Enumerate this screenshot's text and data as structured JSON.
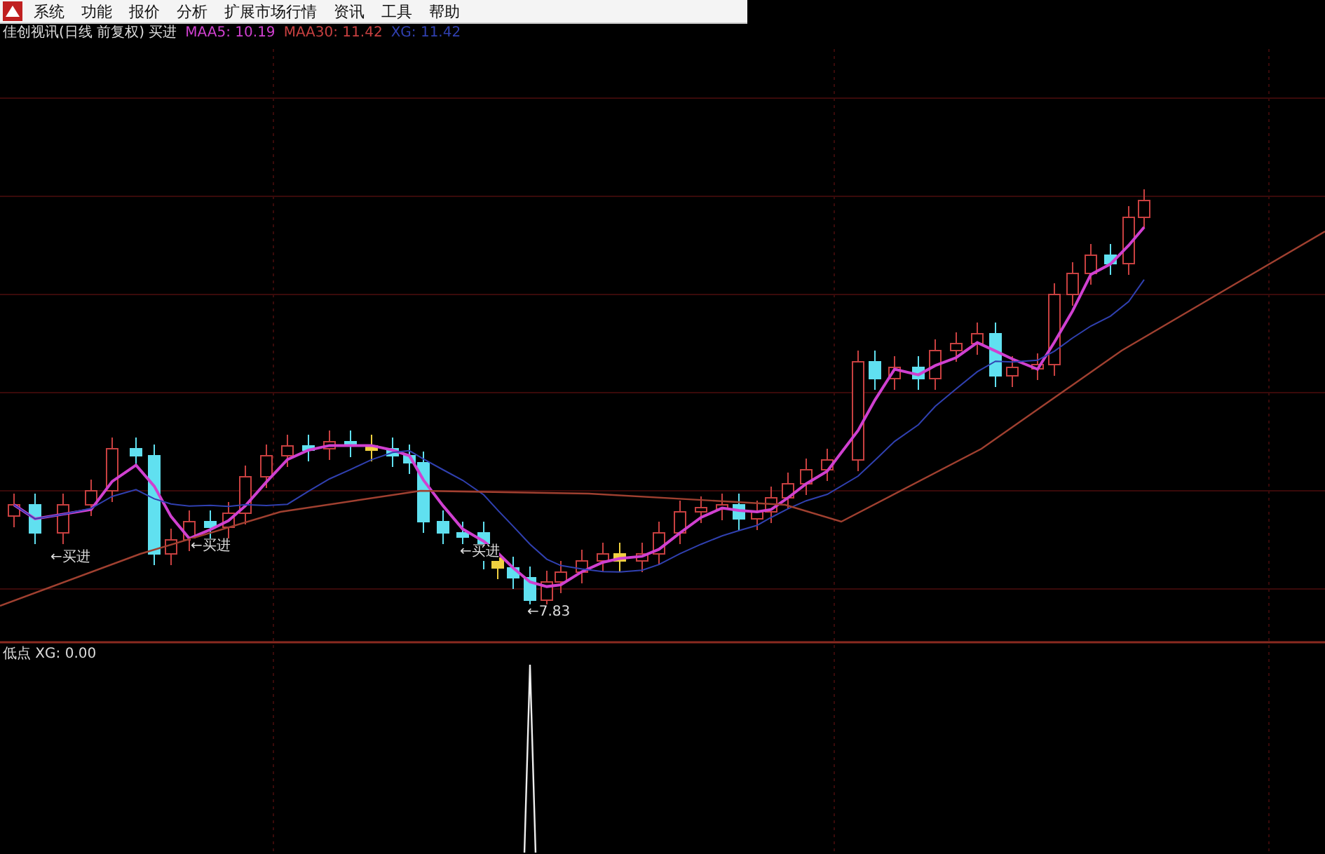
{
  "menu": [
    {
      "label": "系统"
    },
    {
      "label": "功能"
    },
    {
      "label": "报价"
    },
    {
      "label": "分析"
    },
    {
      "label": "扩展市场行情"
    },
    {
      "label": "资讯"
    },
    {
      "label": "工具"
    },
    {
      "label": "帮助"
    }
  ],
  "info_bar": {
    "title": "佳创视讯(日线 前复权) 买进",
    "indicators": [
      {
        "label": "MAA5: 10.19",
        "color": "#d040d0"
      },
      {
        "label": "MAA30: 11.42",
        "color": "#c84040"
      },
      {
        "label": "XG: 11.42",
        "color": "#3040b0"
      }
    ]
  },
  "main_chart": {
    "markers": [
      {
        "label": "←买进"
      },
      {
        "label": "←买进"
      },
      {
        "label": "←买进"
      },
      {
        "label": "←7.83"
      }
    ]
  },
  "lower_panel": {
    "label": "低点 XG: 0.00"
  }
}
